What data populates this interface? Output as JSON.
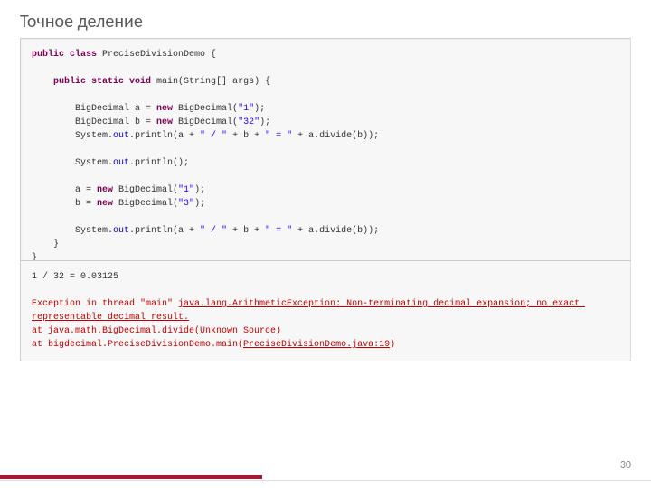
{
  "slide": {
    "title": "Точное деление",
    "page_number": "30"
  },
  "colors": {
    "accent": "#a6192e",
    "keyword": "#7f0055",
    "string": "#2a00ff",
    "error": "#c00000"
  },
  "code": {
    "l1a": "public",
    "l1b": " class",
    "l1c": " PreciseDivisionDemo {",
    "l2a": "    public",
    "l2b": " static",
    "l2c": " void",
    "l2d": " main(String[] args) {",
    "l3a": "        BigDecimal a = ",
    "l3b": "new",
    "l3c": " BigDecimal(",
    "l3d": "\"1\"",
    "l3e": ");",
    "l4a": "        BigDecimal b = ",
    "l4b": "new",
    "l4c": " BigDecimal(",
    "l4d": "\"32\"",
    "l4e": ");",
    "l5a": "        System.",
    "l5b": "out",
    "l5c": ".println(a + ",
    "l5d": "\" / \"",
    "l5e": " + b + ",
    "l5f": "\" = \"",
    "l5g": " + a.divide(b));",
    "l6a": "        System.",
    "l6b": "out",
    "l6c": ".println();",
    "l7a": "        a = ",
    "l7b": "new",
    "l7c": " BigDecimal(",
    "l7d": "\"1\"",
    "l7e": ");",
    "l8a": "        b = ",
    "l8b": "new",
    "l8c": " BigDecimal(",
    "l8d": "\"3\"",
    "l8e": ");",
    "l9a": "        System.",
    "l9b": "out",
    "l9c": ".println(a + ",
    "l9d": "\" / \"",
    "l9e": " + b + ",
    "l9f": "\" = \"",
    "l9g": " + a.divide(b));",
    "l10": "    }",
    "l11": "}"
  },
  "output": {
    "l1": "1 / 32 = 0.03125",
    "l2a": "Exception in thread \"main\" ",
    "l2b": "java.lang.ArithmeticException",
    "l2c": ": Non-terminating decimal expansion; no exact representable decimal result.",
    "l3": "at java.math.BigDecimal.divide(Unknown Source)",
    "l4a": "at bigdecimal.PreciseDivisionDemo.main(",
    "l4b": "PreciseDivisionDemo.java:19",
    "l4c": ")"
  }
}
